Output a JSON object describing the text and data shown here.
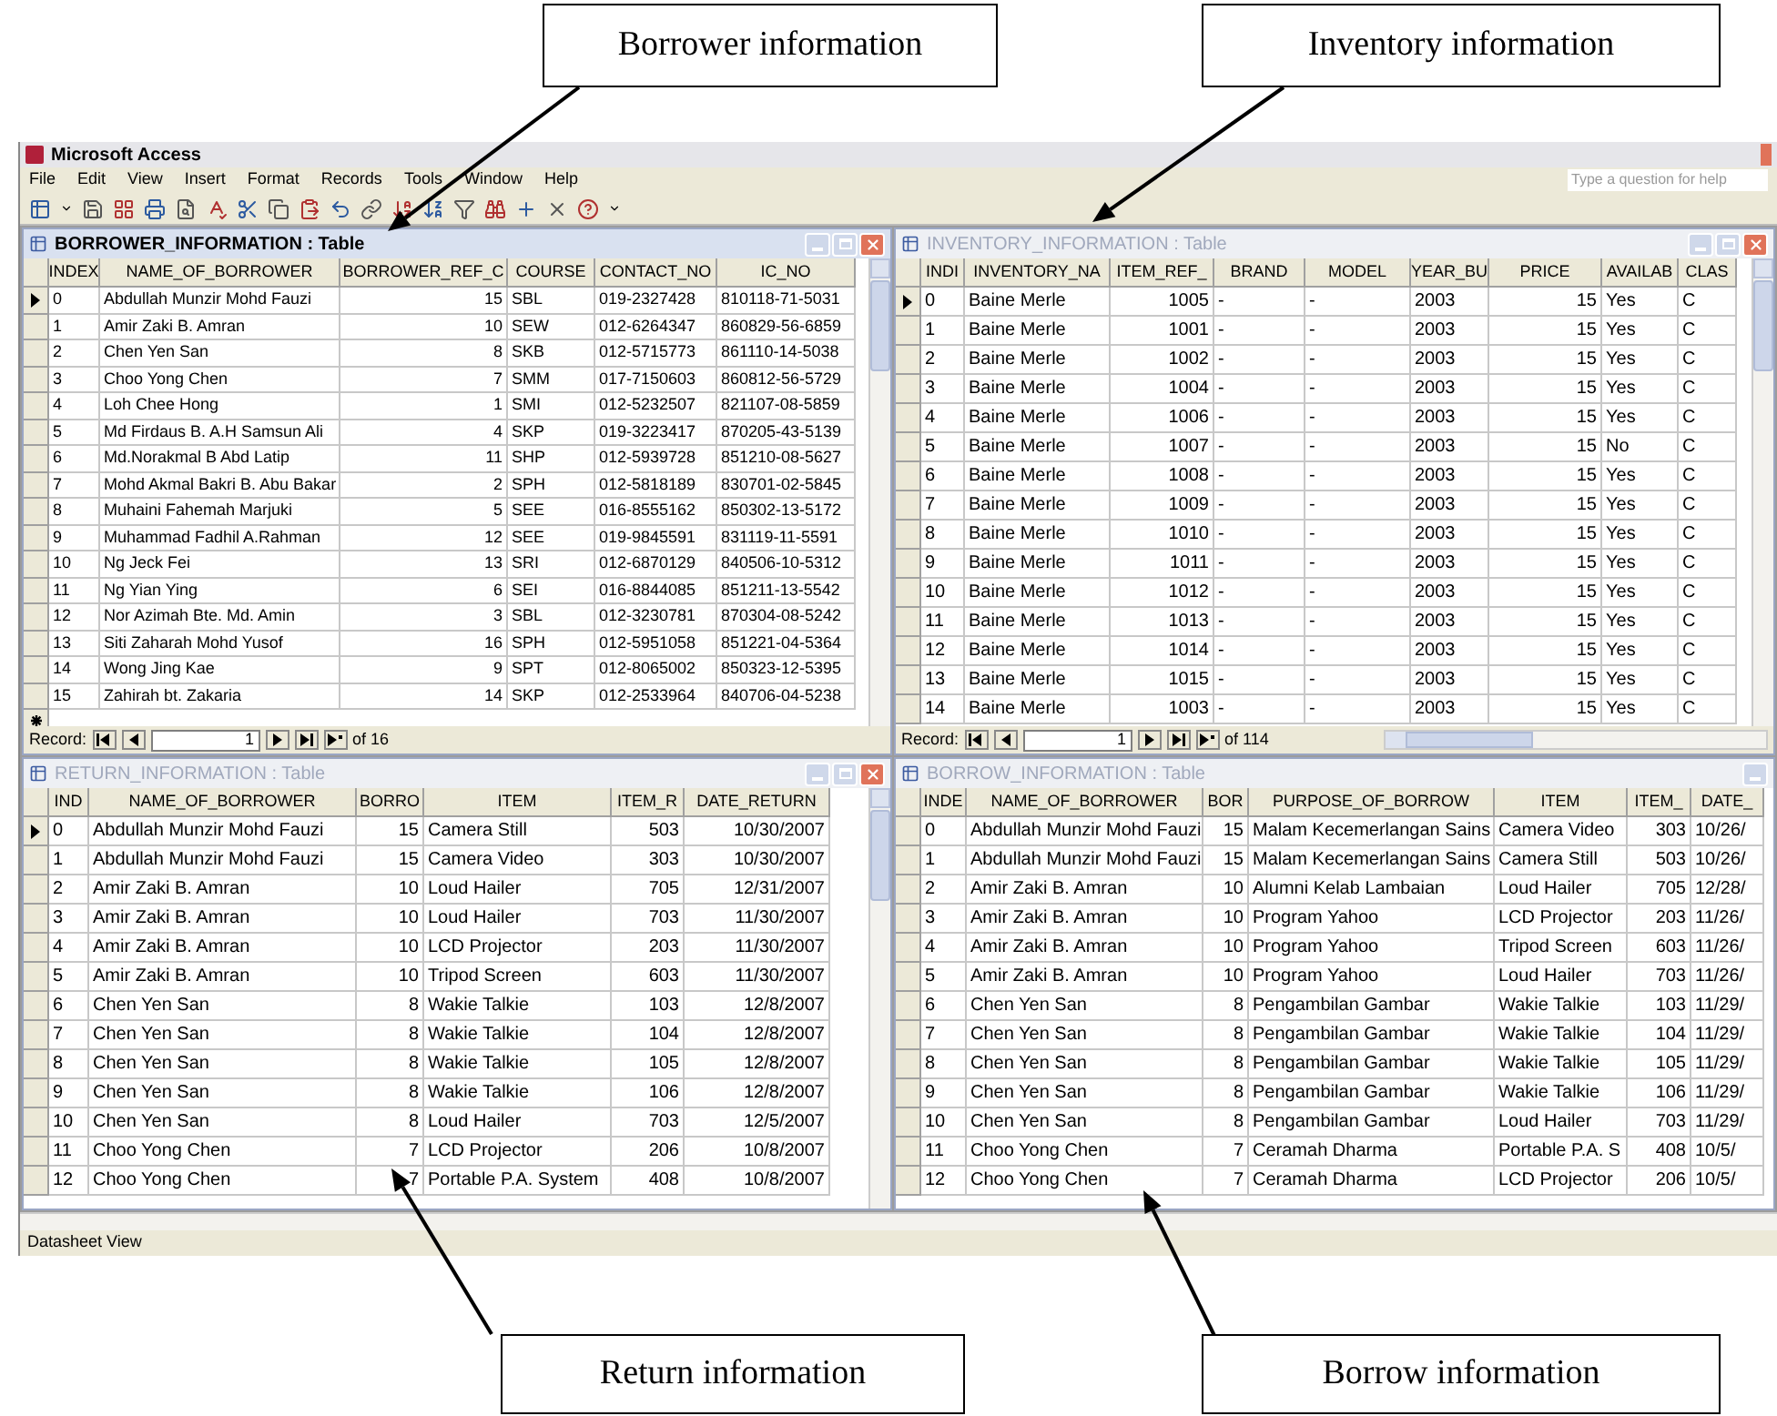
{
  "window": {
    "title": "Microsoft Access"
  },
  "menu": [
    "File",
    "Edit",
    "View",
    "Insert",
    "Format",
    "Records",
    "Tools",
    "Window",
    "Help"
  ],
  "help_box": {
    "placeholder": "Type a question for help"
  },
  "tables": [
    {
      "title": "BORROWER_INFORMATION : Table",
      "active": true,
      "buttons_cut_off": false,
      "vertical_scrollbar": true,
      "new_record_row": true,
      "columns": [
        "INDEX",
        "NAME_OF_BORROWER",
        "BORROWER_REF_C",
        "COURSE",
        "CONTACT_NO",
        "IC_NO"
      ],
      "rows": [
        {
          "current": true,
          "cells": [
            "0",
            "Abdullah Munzir Mohd Fauzi",
            "15",
            "SBL",
            "019-2327428",
            "810118-71-5031"
          ]
        },
        {
          "current": false,
          "cells": [
            "1",
            "Amir Zaki B. Amran",
            "10",
            "SEW",
            "012-6264347",
            "860829-56-6859"
          ]
        },
        {
          "current": false,
          "cells": [
            "2",
            "Chen Yen San",
            "8",
            "SKB",
            "012-5715773",
            "861110-14-5038"
          ]
        },
        {
          "current": false,
          "cells": [
            "3",
            "Choo Yong Chen",
            "7",
            "SMM",
            "017-7150603",
            "860812-56-5729"
          ]
        },
        {
          "current": false,
          "cells": [
            "4",
            "Loh Chee Hong",
            "1",
            "SMI",
            "012-5232507",
            "821107-08-5859"
          ]
        },
        {
          "current": false,
          "cells": [
            "5",
            "Md Firdaus B. A.H Samsun Ali",
            "4",
            "SKP",
            "019-3223417",
            "870205-43-5139"
          ]
        },
        {
          "current": false,
          "cells": [
            "6",
            "Md.Norakmal B Abd Latip",
            "11",
            "SHP",
            "012-5939728",
            "851210-08-5627"
          ]
        },
        {
          "current": false,
          "cells": [
            "7",
            "Mohd Akmal Bakri B. Abu Bakar",
            "2",
            "SPH",
            "012-5818189",
            "830701-02-5845"
          ]
        },
        {
          "current": false,
          "cells": [
            "8",
            "Muhaini Fahemah Marjuki",
            "5",
            "SEE",
            "016-8555162",
            "850302-13-5172"
          ]
        },
        {
          "current": false,
          "cells": [
            "9",
            "Muhammad Fadhil A.Rahman",
            "12",
            "SEE",
            "019-9845591",
            "831119-11-5591"
          ]
        },
        {
          "current": false,
          "cells": [
            "10",
            "Ng Jeck Fei",
            "13",
            "SRI",
            "012-6870129",
            "840506-10-5312"
          ]
        },
        {
          "current": false,
          "cells": [
            "11",
            "Ng Yian Ying",
            "6",
            "SEI",
            "016-8844085",
            "851211-13-5542"
          ]
        },
        {
          "current": false,
          "cells": [
            "12",
            "Nor Azimah Bte. Md. Amin",
            "3",
            "SBL",
            "012-3230781",
            "870304-08-5242"
          ]
        },
        {
          "current": false,
          "cells": [
            "13",
            "Siti Zaharah Mohd Yusof",
            "16",
            "SPH",
            "012-5951058",
            "851221-04-5364"
          ]
        },
        {
          "current": false,
          "cells": [
            "14",
            "Wong Jing Kae",
            "9",
            "SPT",
            "012-8065002",
            "850323-12-5395"
          ]
        },
        {
          "current": false,
          "cells": [
            "15",
            "Zahirah bt. Zakaria",
            "14",
            "SKP",
            "012-2533964",
            "840706-04-5238"
          ]
        }
      ],
      "nav": {
        "label": "Record:",
        "value": "1",
        "total": "of 16",
        "horizontal_scrollbar": false
      }
    },
    {
      "title": "INVENTORY_INFORMATION : Table",
      "active": false,
      "buttons_cut_off": false,
      "vertical_scrollbar": true,
      "new_record_row": false,
      "columns": [
        "INDI",
        "INVENTORY_NA",
        "ITEM_REF_",
        "BRAND",
        "MODEL",
        "YEAR_BU",
        "PRICE",
        "AVAILAB",
        "CLAS"
      ],
      "rows": [
        {
          "current": true,
          "cells": [
            "0",
            "Baine Merle",
            "1005",
            "-",
            "-",
            "2003",
            "15",
            "Yes",
            "C"
          ]
        },
        {
          "current": false,
          "cells": [
            "1",
            "Baine Merle",
            "1001",
            "-",
            "-",
            "2003",
            "15",
            "Yes",
            "C"
          ]
        },
        {
          "current": false,
          "cells": [
            "2",
            "Baine Merle",
            "1002",
            "-",
            "-",
            "2003",
            "15",
            "Yes",
            "C"
          ]
        },
        {
          "current": false,
          "cells": [
            "3",
            "Baine Merle",
            "1004",
            "-",
            "-",
            "2003",
            "15",
            "Yes",
            "C"
          ]
        },
        {
          "current": false,
          "cells": [
            "4",
            "Baine Merle",
            "1006",
            "-",
            "-",
            "2003",
            "15",
            "Yes",
            "C"
          ]
        },
        {
          "current": false,
          "cells": [
            "5",
            "Baine Merle",
            "1007",
            "-",
            "-",
            "2003",
            "15",
            "No",
            "C"
          ]
        },
        {
          "current": false,
          "cells": [
            "6",
            "Baine Merle",
            "1008",
            "-",
            "-",
            "2003",
            "15",
            "Yes",
            "C"
          ]
        },
        {
          "current": false,
          "cells": [
            "7",
            "Baine Merle",
            "1009",
            "-",
            "-",
            "2003",
            "15",
            "Yes",
            "C"
          ]
        },
        {
          "current": false,
          "cells": [
            "8",
            "Baine Merle",
            "1010",
            "-",
            "-",
            "2003",
            "15",
            "Yes",
            "C"
          ]
        },
        {
          "current": false,
          "cells": [
            "9",
            "Baine Merle",
            "1011",
            "-",
            "-",
            "2003",
            "15",
            "Yes",
            "C"
          ]
        },
        {
          "current": false,
          "cells": [
            "10",
            "Baine Merle",
            "1012",
            "-",
            "-",
            "2003",
            "15",
            "Yes",
            "C"
          ]
        },
        {
          "current": false,
          "cells": [
            "11",
            "Baine Merle",
            "1013",
            "-",
            "-",
            "2003",
            "15",
            "Yes",
            "C"
          ]
        },
        {
          "current": false,
          "cells": [
            "12",
            "Baine Merle",
            "1014",
            "-",
            "-",
            "2003",
            "15",
            "Yes",
            "C"
          ]
        },
        {
          "current": false,
          "cells": [
            "13",
            "Baine Merle",
            "1015",
            "-",
            "-",
            "2003",
            "15",
            "Yes",
            "C"
          ]
        },
        {
          "current": false,
          "cells": [
            "14",
            "Baine Merle",
            "1003",
            "-",
            "-",
            "2003",
            "15",
            "Yes",
            "C"
          ]
        }
      ],
      "nav": {
        "label": "Record:",
        "value": "1",
        "total": "of 114",
        "horizontal_scrollbar": true
      }
    },
    {
      "title": "RETURN_INFORMATION : Table",
      "active": false,
      "buttons_cut_off": false,
      "vertical_scrollbar": true,
      "new_record_row": false,
      "columns": [
        "IND",
        "NAME_OF_BORROWER",
        "BORRO",
        "ITEM",
        "ITEM_R",
        "DATE_RETURN"
      ],
      "rows": [
        {
          "current": true,
          "cells": [
            "0",
            "Abdullah Munzir Mohd Fauzi",
            "15",
            "Camera Still",
            "503",
            "10/30/2007"
          ]
        },
        {
          "current": false,
          "cells": [
            "1",
            "Abdullah Munzir Mohd Fauzi",
            "15",
            "Camera Video",
            "303",
            "10/30/2007"
          ]
        },
        {
          "current": false,
          "cells": [
            "2",
            "Amir Zaki B. Amran",
            "10",
            "Loud Hailer",
            "705",
            "12/31/2007"
          ]
        },
        {
          "current": false,
          "cells": [
            "3",
            "Amir Zaki B. Amran",
            "10",
            "Loud Hailer",
            "703",
            "11/30/2007"
          ]
        },
        {
          "current": false,
          "cells": [
            "4",
            "Amir Zaki B. Amran",
            "10",
            "LCD Projector",
            "203",
            "11/30/2007"
          ]
        },
        {
          "current": false,
          "cells": [
            "5",
            "Amir Zaki B. Amran",
            "10",
            "Tripod Screen",
            "603",
            "11/30/2007"
          ]
        },
        {
          "current": false,
          "cells": [
            "6",
            "Chen Yen San",
            "8",
            "Wakie Talkie",
            "103",
            "12/8/2007"
          ]
        },
        {
          "current": false,
          "cells": [
            "7",
            "Chen Yen San",
            "8",
            "Wakie Talkie",
            "104",
            "12/8/2007"
          ]
        },
        {
          "current": false,
          "cells": [
            "8",
            "Chen Yen San",
            "8",
            "Wakie Talkie",
            "105",
            "12/8/2007"
          ]
        },
        {
          "current": false,
          "cells": [
            "9",
            "Chen Yen San",
            "8",
            "Wakie Talkie",
            "106",
            "12/8/2007"
          ]
        },
        {
          "current": false,
          "cells": [
            "10",
            "Chen Yen San",
            "8",
            "Loud Hailer",
            "703",
            "12/5/2007"
          ]
        },
        {
          "current": false,
          "cells": [
            "11",
            "Choo Yong Chen",
            "7",
            "LCD Projector",
            "206",
            "10/8/2007"
          ]
        },
        {
          "current": false,
          "cells": [
            "12",
            "Choo Yong Chen",
            "7",
            "Portable P.A. System",
            "408",
            "10/8/2007"
          ]
        }
      ]
    },
    {
      "title": "BORROW_INFORMATION : Table",
      "active": false,
      "buttons_cut_off": true,
      "vertical_scrollbar": false,
      "new_record_row": false,
      "columns": [
        "INDE",
        "NAME_OF_BORROWER",
        "BOR",
        "PURPOSE_OF_BORROW",
        "ITEM",
        "ITEM_",
        "DATE_"
      ],
      "rows": [
        {
          "current": false,
          "cells": [
            "0",
            "Abdullah Munzir Mohd Fauzi",
            "15",
            "Malam Kecemerlangan Sains",
            "Camera Video",
            "303",
            "10/26/"
          ]
        },
        {
          "current": false,
          "cells": [
            "1",
            "Abdullah Munzir Mohd Fauzi",
            "15",
            "Malam Kecemerlangan Sains",
            "Camera Still",
            "503",
            "10/26/"
          ]
        },
        {
          "current": false,
          "cells": [
            "2",
            "Amir Zaki B. Amran",
            "10",
            "Alumni Kelab Lambaian",
            "Loud Hailer",
            "705",
            "12/28/"
          ]
        },
        {
          "current": false,
          "cells": [
            "3",
            "Amir Zaki B. Amran",
            "10",
            "Program Yahoo",
            "LCD Projector",
            "203",
            "11/26/"
          ]
        },
        {
          "current": false,
          "cells": [
            "4",
            "Amir Zaki B. Amran",
            "10",
            "Program Yahoo",
            "Tripod Screen",
            "603",
            "11/26/"
          ]
        },
        {
          "current": false,
          "cells": [
            "5",
            "Amir Zaki B. Amran",
            "10",
            "Program Yahoo",
            "Loud Hailer",
            "703",
            "11/26/"
          ]
        },
        {
          "current": false,
          "cells": [
            "6",
            "Chen Yen San",
            "8",
            "Pengambilan Gambar",
            "Wakie Talkie",
            "103",
            "11/29/"
          ]
        },
        {
          "current": false,
          "cells": [
            "7",
            "Chen Yen San",
            "8",
            "Pengambilan Gambar",
            "Wakie Talkie",
            "104",
            "11/29/"
          ]
        },
        {
          "current": false,
          "cells": [
            "8",
            "Chen Yen San",
            "8",
            "Pengambilan Gambar",
            "Wakie Talkie",
            "105",
            "11/29/"
          ]
        },
        {
          "current": false,
          "cells": [
            "9",
            "Chen Yen San",
            "8",
            "Pengambilan Gambar",
            "Wakie Talkie",
            "106",
            "11/29/"
          ]
        },
        {
          "current": false,
          "cells": [
            "10",
            "Chen Yen San",
            "8",
            "Pengambilan Gambar",
            "Loud Hailer",
            "703",
            "11/29/"
          ]
        },
        {
          "current": false,
          "cells": [
            "11",
            "Choo Yong Chen",
            "7",
            "Ceramah Dharma",
            "Portable P.A. S",
            "408",
            "10/5/"
          ]
        },
        {
          "current": false,
          "cells": [
            "12",
            "Choo Yong Chen",
            "7",
            "Ceramah Dharma",
            "LCD Projector",
            "206",
            "10/5/"
          ]
        }
      ]
    }
  ],
  "status_bar": "Datasheet View",
  "callouts": [
    {
      "text": "Borrower information"
    },
    {
      "text": "Inventory information"
    },
    {
      "text": "Return information"
    },
    {
      "text": "Borrow information"
    }
  ]
}
